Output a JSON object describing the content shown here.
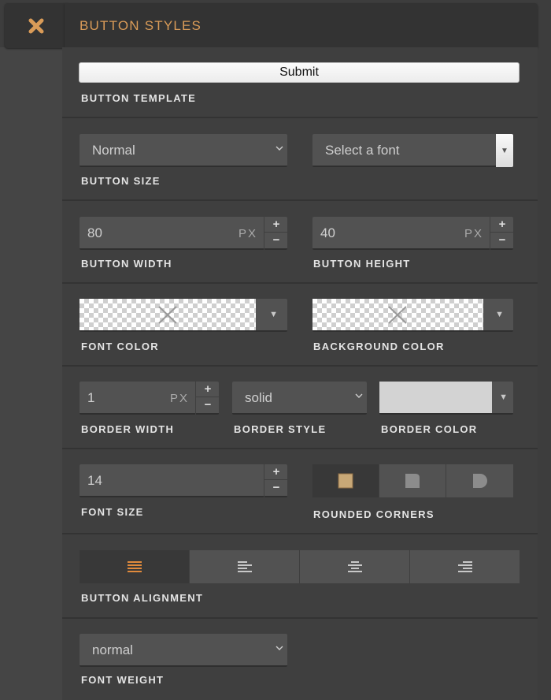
{
  "header": {
    "title": "BUTTON STYLES",
    "close_icon": "close-x-icon"
  },
  "template": {
    "preview_label": "Submit",
    "label": "BUTTON TEMPLATE"
  },
  "size": {
    "value": "Normal",
    "label": "BUTTON SIZE"
  },
  "font_select": {
    "placeholder": "Select a font"
  },
  "width": {
    "value": "80",
    "unit": "PX",
    "label": "BUTTON WIDTH"
  },
  "height": {
    "value": "40",
    "unit": "PX",
    "label": "BUTTON HEIGHT"
  },
  "font_color": {
    "label": "FONT COLOR"
  },
  "bg_color": {
    "label": "BACKGROUND COLOR"
  },
  "border_width": {
    "value": "1",
    "unit": "PX",
    "label": "BORDER WIDTH"
  },
  "border_style": {
    "value": "solid",
    "label": "BORDER STYLE"
  },
  "border_color": {
    "label": "BORDER COLOR",
    "swatch": "#d3d3d3"
  },
  "font_size": {
    "value": "14",
    "label": "FONT SIZE"
  },
  "corners": {
    "label": "ROUNDED CORNERS",
    "options": [
      "square-corner-icon",
      "rounded-corner-icon",
      "round-corner-icon"
    ],
    "selected": 0
  },
  "alignment": {
    "label": "BUTTON ALIGNMENT",
    "options": [
      "align-justify-icon",
      "align-left-icon",
      "align-center-icon",
      "align-right-icon"
    ],
    "selected": 0
  },
  "font_weight": {
    "value": "normal",
    "label": "FONT WEIGHT"
  },
  "colors": {
    "accent": "#d99b58",
    "panel": "#3f3f3f",
    "field": "#525252"
  }
}
